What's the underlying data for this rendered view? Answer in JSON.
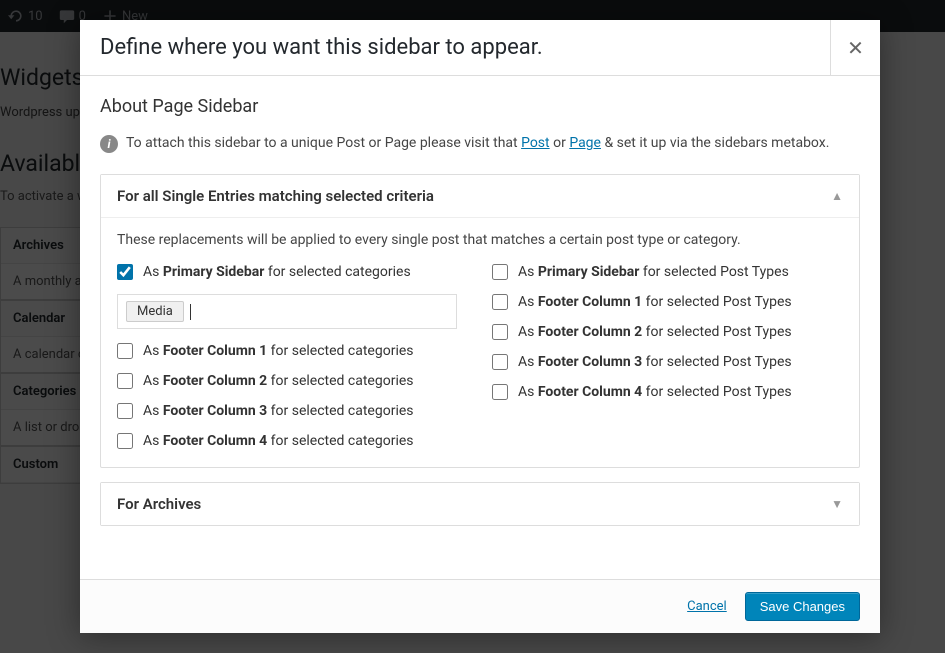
{
  "adminbar": {
    "updates": "10",
    "comments": "0",
    "new": "New"
  },
  "bg": {
    "h1": "Widgets",
    "desc": "Wordpress update your",
    "available_title": "Available",
    "help": "To activate a widget. To deactivate it and drag it back.",
    "widgets": [
      {
        "title": "Archives",
        "desc": "A monthly archive of your posts."
      },
      {
        "title": "Calendar",
        "desc": "A calendar of your posts."
      },
      {
        "title": "Categories",
        "desc": "A list or dropdown of categories."
      },
      {
        "title": "Custom",
        "desc": ""
      }
    ]
  },
  "modal": {
    "title": "Define where you want this sidebar to appear.",
    "subtitle": "About Page Sidebar",
    "info_pre": "To attach this sidebar to a unique Post or Page please visit that ",
    "link_post": "Post",
    "info_or": " or ",
    "link_page": "Page",
    "info_post": " & set it up via the sidebars metabox.",
    "section1_title": "For all Single Entries matching selected criteria",
    "section1_help": "These replacements will be applied to every single post that matches a certain post type or category.",
    "as": "As ",
    "for_cat": " for selected categories",
    "for_pt": " for selected Post Types",
    "primary": "Primary Sidebar",
    "fc1": "Footer Column 1",
    "fc2": "Footer Column 2",
    "fc3": "Footer Column 3",
    "fc4": "Footer Column 4",
    "tag": "Media",
    "section2_title": "For Archives",
    "cancel": "Cancel",
    "save": "Save Changes"
  }
}
